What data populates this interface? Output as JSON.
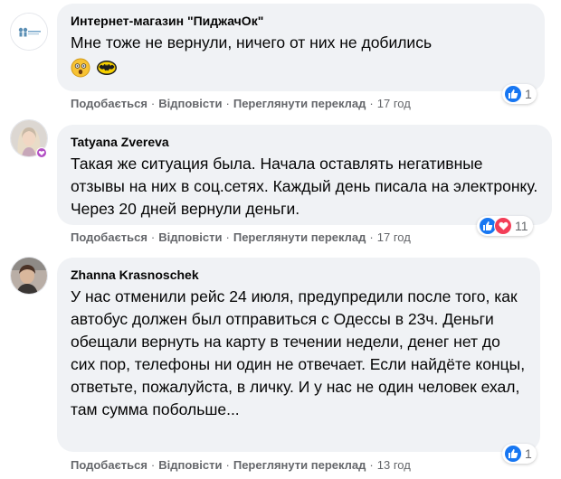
{
  "comments": [
    {
      "author": "Интернет-магазин \"ПиджачОк\"",
      "text": "Мне тоже не вернули, ничего от них не добились",
      "emojis": [
        "astonished-face",
        "batman"
      ],
      "actions": {
        "like": "Подобається",
        "reply": "Відповісти",
        "translate": "Переглянути переклад",
        "time": "17 год"
      },
      "reactions": {
        "icons": [
          "like"
        ],
        "count": "1"
      }
    },
    {
      "author": "Tatyana Zvereva",
      "text": "Такая же ситуация была. Начала оставлять негативные отзывы на них в соц.сетях. Каждый день писала на электронку. Через 20 дней вернули деньги.",
      "actions": {
        "like": "Подобається",
        "reply": "Відповісти",
        "translate": "Переглянути переклад",
        "time": "17 год"
      },
      "reactions": {
        "icons": [
          "like",
          "love"
        ],
        "count": "11"
      }
    },
    {
      "author": "Zhanna Krasnoschek",
      "text": "У нас отменили рейс 24 июля, предупредили после того, как автобус должен был отправиться с Одессы в 23ч. Деньги обещали вернуть на карту в течении недели, денег нет до сих пор, телефоны ни один не отвечает. Если найдёте концы, ответьте, пожалуйста, в личку. И у нас не один человек ехал, там сумма побольше...",
      "actions": {
        "like": "Подобається",
        "reply": "Відповісти",
        "translate": "Переглянути переклад",
        "time": "13 год"
      },
      "reactions": {
        "icons": [
          "like"
        ],
        "count": "1"
      }
    }
  ],
  "colors": {
    "bubble": "#f0f2f5",
    "like": "#1877f2",
    "love": "#f33e58",
    "muted": "#65676b"
  }
}
